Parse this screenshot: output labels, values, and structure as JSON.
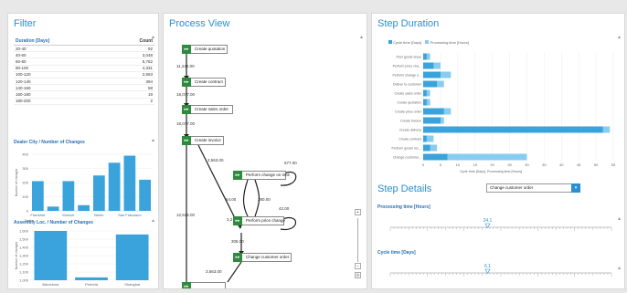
{
  "filter": {
    "title": "Filter",
    "table": {
      "headers": [
        "Duration [Days]",
        "Count"
      ],
      "rows": [
        [
          "20-40",
          "92"
        ],
        [
          "40-60",
          "3,048"
        ],
        [
          "60-80",
          "5,752"
        ],
        [
          "80-100",
          "4,331"
        ],
        [
          "100-120",
          "2,553"
        ],
        [
          "120-140",
          "394"
        ],
        [
          "140-160",
          "58"
        ],
        [
          "160-180",
          "19"
        ],
        [
          "180-200",
          "2"
        ]
      ]
    },
    "dealer_chart": {
      "title": "Dealer City / Number of Changes",
      "ylabel": "Number of changes",
      "xlabel": "Dealer",
      "yticks": [
        "400",
        "300",
        "200",
        "100",
        "0"
      ],
      "xticks": [
        "Frankfurt",
        "Munich",
        "Berlin",
        "San Francisco"
      ]
    },
    "assembly_chart": {
      "title": "Assembly Loc. / Number of Changes",
      "ylabel": "Number of changes",
      "xlabel": "Assembly location",
      "yticks": [
        "1,600",
        "1,500",
        "1,400",
        "1,300",
        "1,200",
        "1,100",
        "1,000"
      ],
      "xticks": [
        "Barcelona",
        "Pretoria",
        "Shanghai"
      ]
    }
  },
  "process": {
    "title": "Process View",
    "nodes": {
      "create_quotation": "Create quotation",
      "create_contract": "Create contract",
      "create_sales_order": "Create sales order",
      "create_invoice": "Create invoice",
      "perform_change_on_time": "Perform change on time",
      "perform_price_change": "Perform price change",
      "change_customer_order": "Change customer order"
    },
    "edges": {
      "e1": "11,244.00",
      "e2": "18,077.00",
      "e3": "18,077.00",
      "e4": "3,563.00",
      "e5": "12,514.00",
      "e6": "677.00",
      "e7": "64.00",
      "e8": "380.00",
      "e9": "42.00",
      "e10": "3,2",
      "e11": "308.00",
      "e12": "3,563.00"
    },
    "zoom": {
      "plus": "+",
      "minus": "−",
      "reset": "⊙"
    }
  },
  "step_duration": {
    "title": "Step Duration",
    "legend": [
      "Cycle time [Days]",
      "Processing time [Hours]"
    ],
    "x_axis_label": "Cycle time [Days], Processing time [Hours]",
    "xticks": [
      "0",
      "5",
      "10",
      "15",
      "20",
      "25",
      "30",
      "35",
      "40",
      "45",
      "50",
      "55"
    ]
  },
  "chart_data": [
    {
      "type": "bar",
      "title": "Dealer City / Number of Changes",
      "xlabel": "Dealer",
      "ylabel": "Number of changes",
      "categories": [
        "Frankfurt",
        "",
        "Munich",
        "",
        "Berlin",
        "",
        "San Francisco",
        ""
      ],
      "values": [
        210,
        30,
        210,
        40,
        250,
        340,
        390,
        220
      ],
      "ylim": [
        0,
        400
      ]
    },
    {
      "type": "bar",
      "title": "Assembly Loc. / Number of Changes",
      "xlabel": "Assembly location",
      "ylabel": "Number of changes",
      "categories": [
        "Barcelona",
        "Pretoria",
        "Shanghai"
      ],
      "values": [
        1700,
        1040,
        1650
      ],
      "ylim": [
        1000,
        1700
      ]
    },
    {
      "type": "bar",
      "title": "Step Duration",
      "orientation": "horizontal",
      "categories": [
        "Post goods issue",
        "Perform price cha...",
        "Perform change o...",
        "Deliver to customer",
        "Create sales order",
        "Create quotation",
        "Create price order",
        "Create invoice",
        "Create delivery",
        "Create contract",
        "Perform goods rec...",
        "Change customer..."
      ],
      "series": [
        {
          "name": "Cycle time [Days]",
          "values": [
            1,
            3,
            5,
            4,
            1,
            1,
            6,
            5,
            52,
            1,
            2,
            7
          ]
        },
        {
          "name": "Processing time [Hours]",
          "values": [
            2,
            5,
            8,
            6,
            2,
            2,
            8,
            6,
            54,
            3,
            4,
            30
          ]
        }
      ],
      "xlim": [
        0,
        55
      ],
      "legend": "top-left"
    }
  ],
  "step_details": {
    "title": "Step Details",
    "dropdown_value": "Change customer order",
    "processing_label": "Processing time [Hours]",
    "processing_value": "24.1",
    "processing_fraction": 0.44,
    "cycle_label": "Cycle time [Days]",
    "cycle_value": "6.1",
    "cycle_fraction": 0.44
  },
  "colors": {
    "accent": "#2a8fd0",
    "bar_dark": "#3aa3dc",
    "bar_light": "#86cdf0",
    "node_green": "#2e8b3e"
  }
}
